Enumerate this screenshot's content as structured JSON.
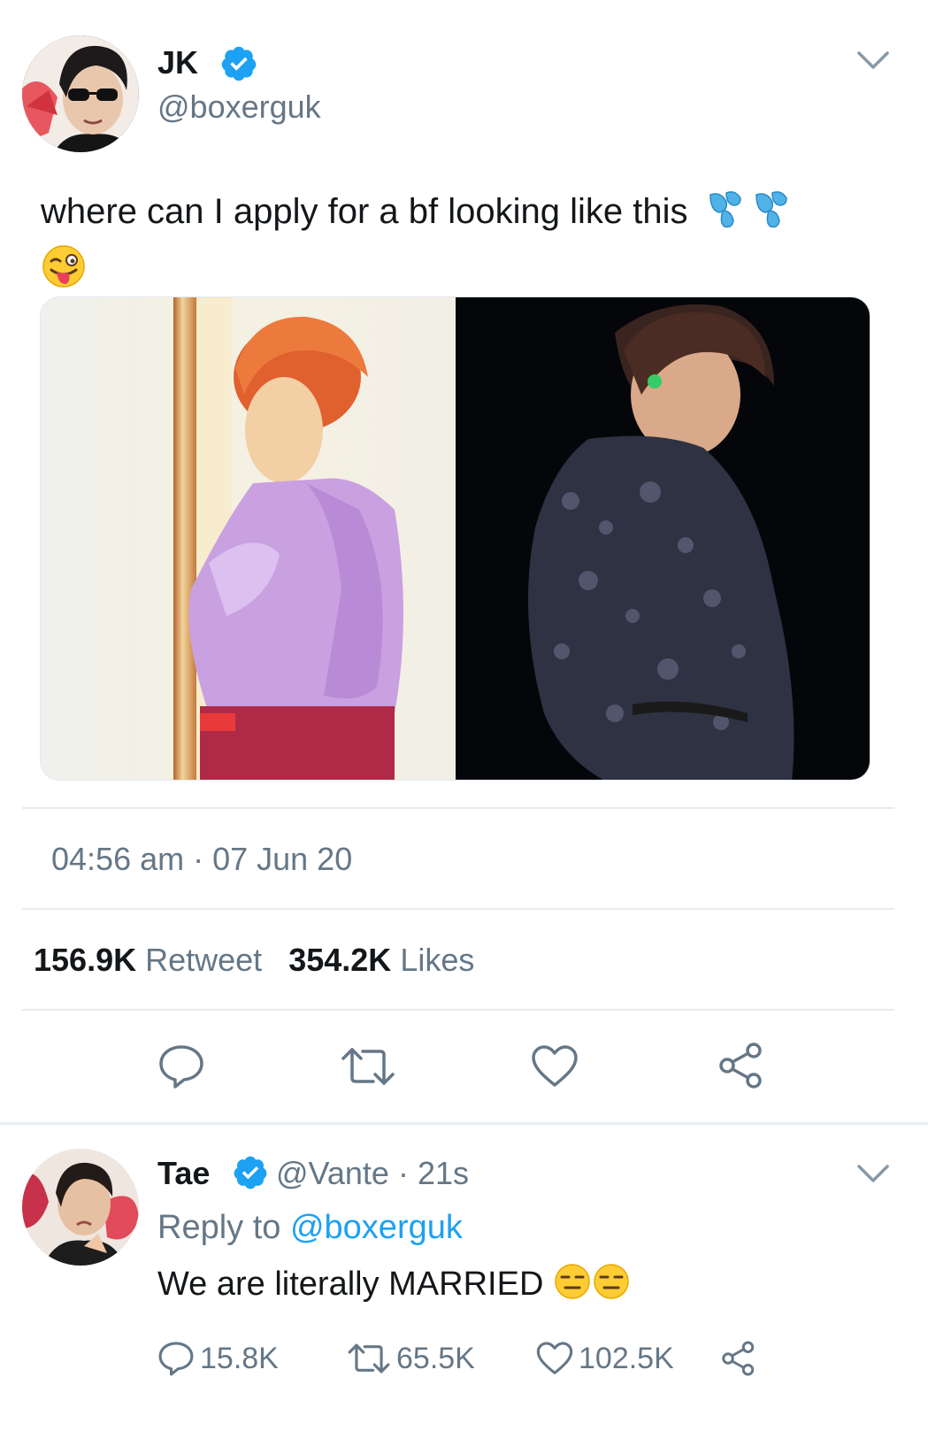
{
  "main_tweet": {
    "display_name": "JK",
    "handle": "@boxerguk",
    "text": "where can I apply for a bf looking like this",
    "text_emojis": [
      "sweat-droplets",
      "sweat-droplets",
      "winking-face-with-tongue"
    ],
    "timestamp": "04:56 am · 07 Jun 20",
    "retweets_count": "156.9K",
    "retweets_label": "Retweet",
    "likes_count": "354.2K",
    "likes_label": "Likes"
  },
  "reply_tweet": {
    "display_name": "Tae",
    "handle": "@Vante",
    "time": "· 21s",
    "reply_to_label": "Reply to",
    "reply_to_handle": "@boxerguk",
    "text": "We are literally MARRIED",
    "text_emojis": [
      "expressionless-face",
      "expressionless-face"
    ],
    "reply_count": "15.8K",
    "retweet_count": "65.5K",
    "like_count": "102.5K"
  },
  "colors": {
    "verified_blue": "#1da1f2",
    "text_primary": "#14171a",
    "text_secondary": "#657786",
    "divider": "#e6ecf0"
  },
  "icons": {
    "verified": "verified-badge-icon",
    "caret": "chevron-down-icon",
    "reply": "reply-bubble-icon",
    "retweet": "retweet-icon",
    "like": "heart-icon",
    "share": "share-icon"
  }
}
